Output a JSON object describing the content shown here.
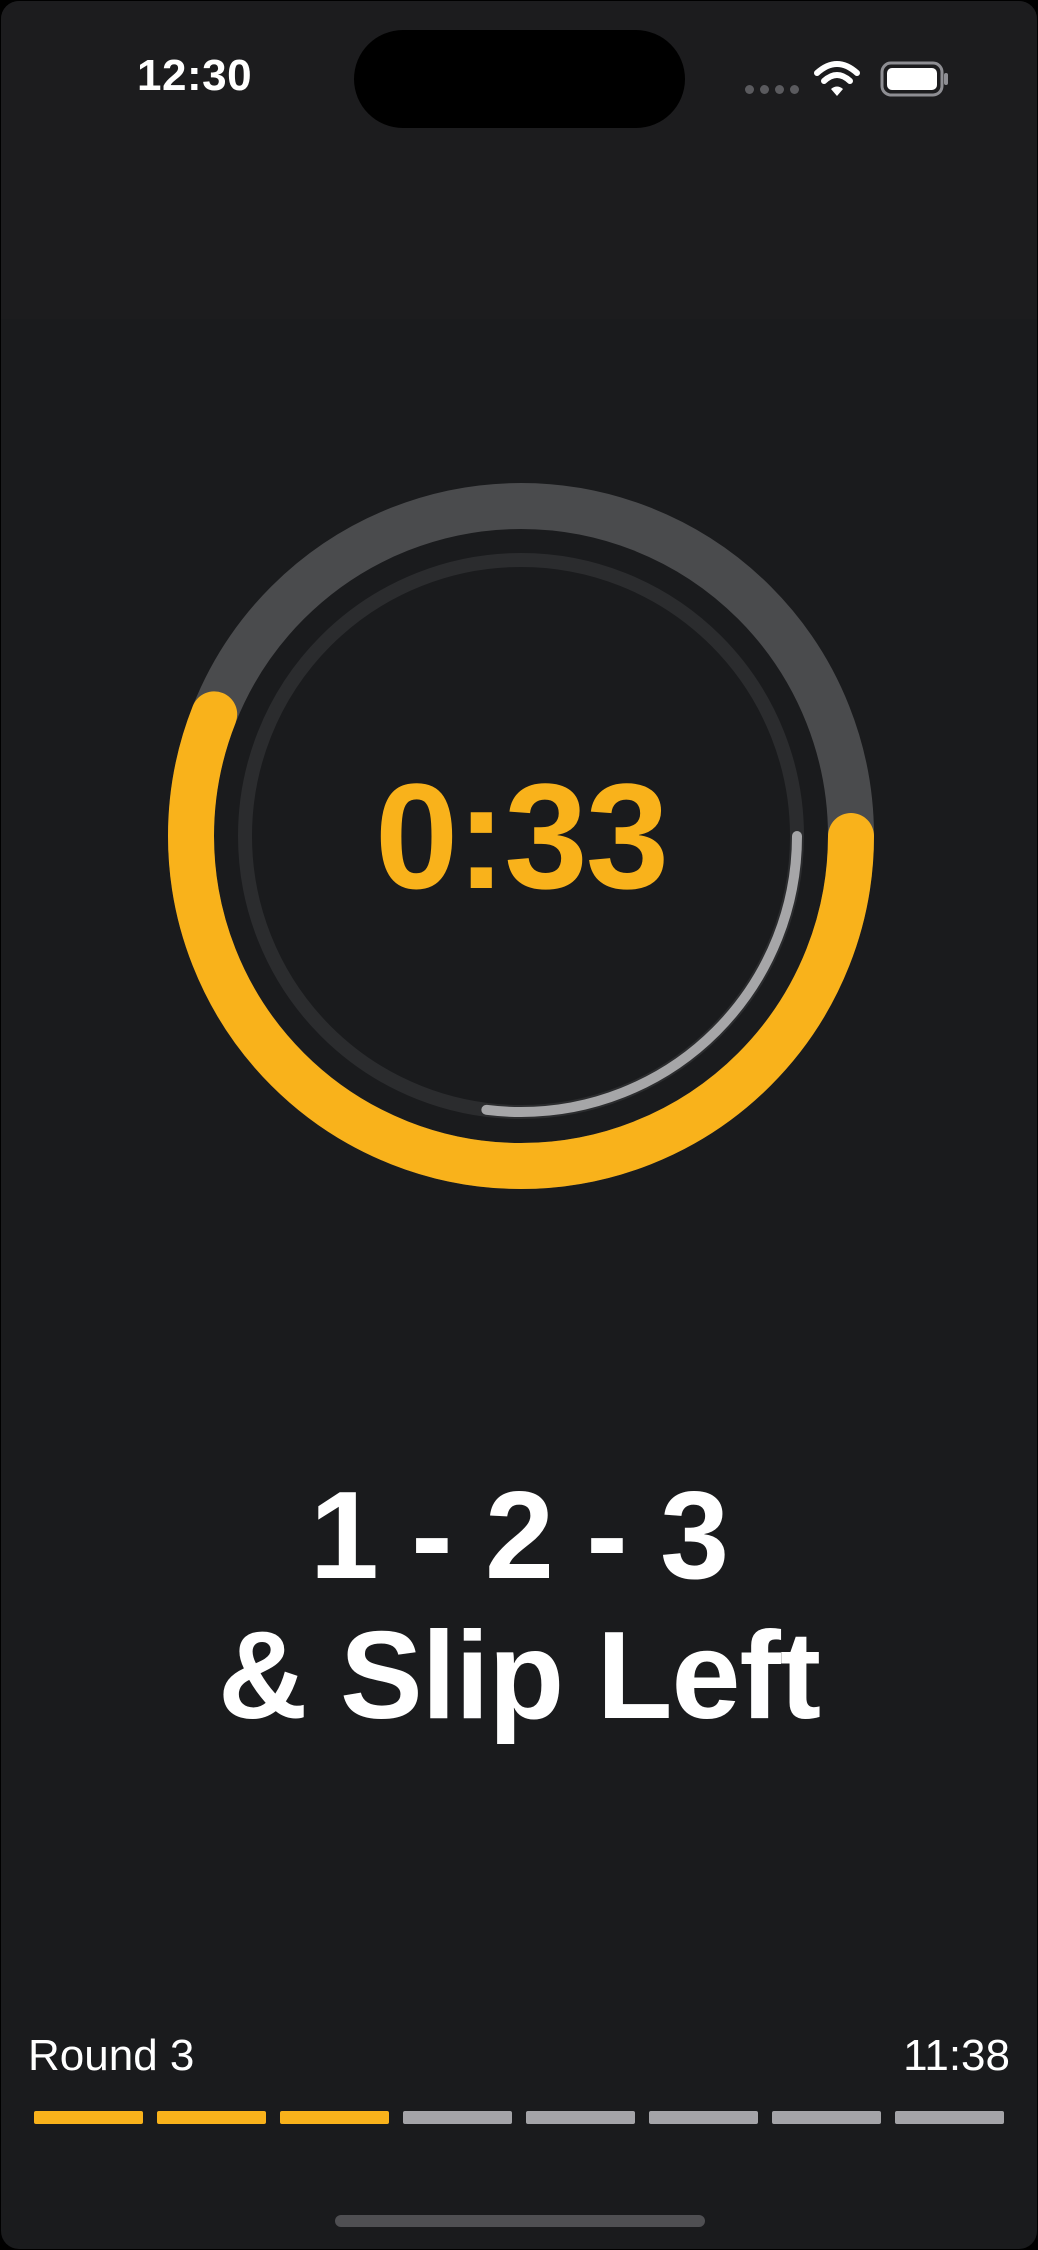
{
  "status_bar": {
    "time": "12:30"
  },
  "timer": {
    "value": "0:33",
    "outer_ring_progress": 0.56,
    "inner_ring_progress": 0.27
  },
  "combo": {
    "line1": "1 - 2 - 3",
    "line2": "& Slip Left"
  },
  "footer": {
    "round_label": "Round 3",
    "total_time": "11:38",
    "rounds_total": 8,
    "rounds_completed": 3
  },
  "colors": {
    "background": "#1a1b1d",
    "accent": "#f9b21b",
    "track": "#4a4b4d",
    "inner_track": "#2b2c2e",
    "inner_progress": "#a6a6a8",
    "inactive_segment": "#a4a4a8"
  }
}
